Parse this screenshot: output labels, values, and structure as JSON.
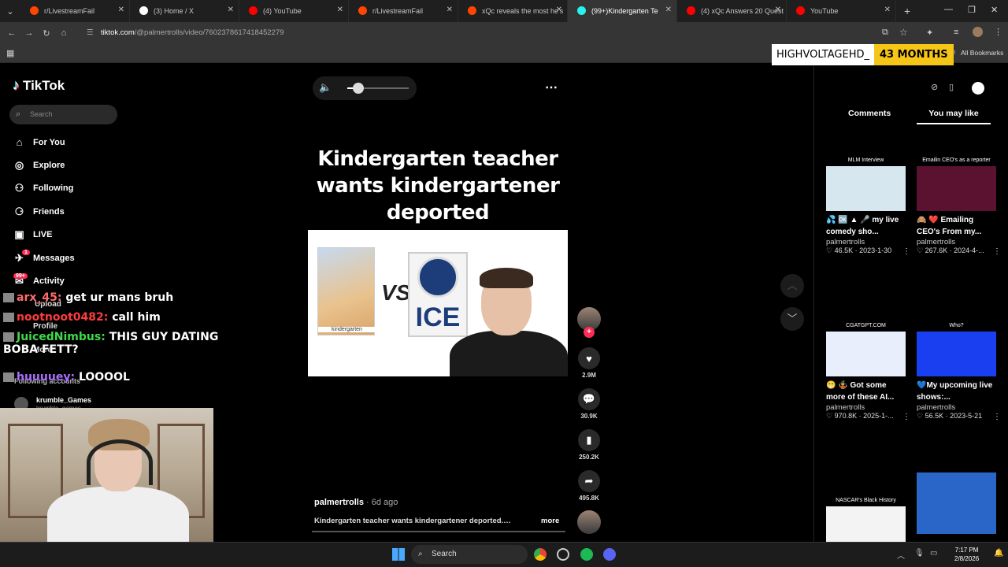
{
  "browser": {
    "tabs": [
      {
        "title": "r/LivestreamFail",
        "color": "#ff4500"
      },
      {
        "title": "(3) Home / X",
        "color": "#ffffff"
      },
      {
        "title": "(4) YouTube",
        "color": "#ff0000"
      },
      {
        "title": "r/LivestreamFail",
        "color": "#ff4500"
      },
      {
        "title": "xQc reveals the most he's",
        "color": "#ff4500"
      },
      {
        "title": "(99+)Kindergarten Te",
        "color": "#25f4ee"
      },
      {
        "title": "(4) xQc Answers 20 Quest",
        "color": "#ff0000"
      },
      {
        "title": "YouTube",
        "color": "#ff0000"
      }
    ],
    "url_host": "tiktok.com",
    "url_path": "/@palmertrolls/video/7602378617418452279",
    "bookmarks_label": "All Bookmarks"
  },
  "sub_alert": {
    "name": "HIGHVOLTAGEHD_",
    "months": "43 MONTHS"
  },
  "tiktok": {
    "logo": "TikTok",
    "search_placeholder": "Search",
    "menu": [
      {
        "label": "For You",
        "icon": "home-icon"
      },
      {
        "label": "Explore",
        "icon": "compass-icon"
      },
      {
        "label": "Following",
        "icon": "following-icon"
      },
      {
        "label": "Friends",
        "icon": "friends-icon"
      },
      {
        "label": "LIVE",
        "icon": "live-icon"
      },
      {
        "label": "Messages",
        "icon": "messages-icon"
      },
      {
        "label": "Activity",
        "icon": "activity-icon"
      }
    ],
    "activity_badge": "99+",
    "messages_badge": "1",
    "hidden_menu": [
      "Upload",
      "Profile",
      "More"
    ],
    "following_accounts": "Following accounts",
    "followed_user": {
      "name": "krumble_Games",
      "handle": "krumble_games"
    }
  },
  "chat": [
    {
      "user": "arx_45:",
      "msg": "get ur mans bruh",
      "color": "#ff6b6b"
    },
    {
      "user": "nootnoot0482:",
      "msg": "call him",
      "color": "#ff3b3b"
    },
    {
      "user": "JuicedNimbus:",
      "msg": "THIS GUY DATING BOBA FETT?",
      "color": "#3fd94a"
    },
    {
      "user": "huuuuey:",
      "msg": "LOOOOL",
      "color": "#a970ff"
    }
  ],
  "video": {
    "title": "Kindergarten teacher wants kindergartener deported",
    "thumb_vs": "VS",
    "thumb_ice": "ICE",
    "thumb_kinder": "kindergarten",
    "author": "palmertrolls",
    "ago": "· 6d ago",
    "caption": "Kindergarten teacher wants kindergartener deported.…",
    "more": "more",
    "volume": 0.18,
    "likes": "2.9M",
    "comments": "30.9K",
    "saves": "250.2K",
    "shares": "495.8K"
  },
  "right_panel": {
    "tabs": [
      "Comments",
      "You may like"
    ],
    "cards": [
      {
        "header": "MLM Interview",
        "title": "💦 🆗 ▲ 🎤 my live comedy sho...",
        "user": "palmertrolls",
        "meta": "♡ 46.5K · 2023-1-30",
        "bg": "#d7e7f0"
      },
      {
        "header": "Emailin CEO's as a reporter",
        "title": "🙈 ❤️ Emailing CEO's From my...",
        "user": "palmertrolls",
        "meta": "♡ 267.6K · 2024-4-...",
        "bg": "#5b1230"
      },
      {
        "header": "CGATGPT.COM",
        "title": "😁 🤹 Got some more of these AI...",
        "user": "palmertrolls",
        "meta": "♡ 970.8K · 2025-1-...",
        "bg": "#e8eefc"
      },
      {
        "header": "Who?",
        "title": "💙My upcoming live shows:...",
        "user": "palmertrolls",
        "meta": "♡ 56.5K · 2023-5-21",
        "bg": "#1a3ff0"
      },
      {
        "header": "NASCAR's Black History",
        "title": "",
        "user": "",
        "meta": "",
        "bg": "#f3f3f3"
      },
      {
        "header": "",
        "title": "",
        "user": "",
        "meta": "",
        "bg": "#2a66c7"
      }
    ]
  },
  "taskbar": {
    "search": "Search",
    "time": "7:17 PM",
    "date": "2/8/2026"
  }
}
